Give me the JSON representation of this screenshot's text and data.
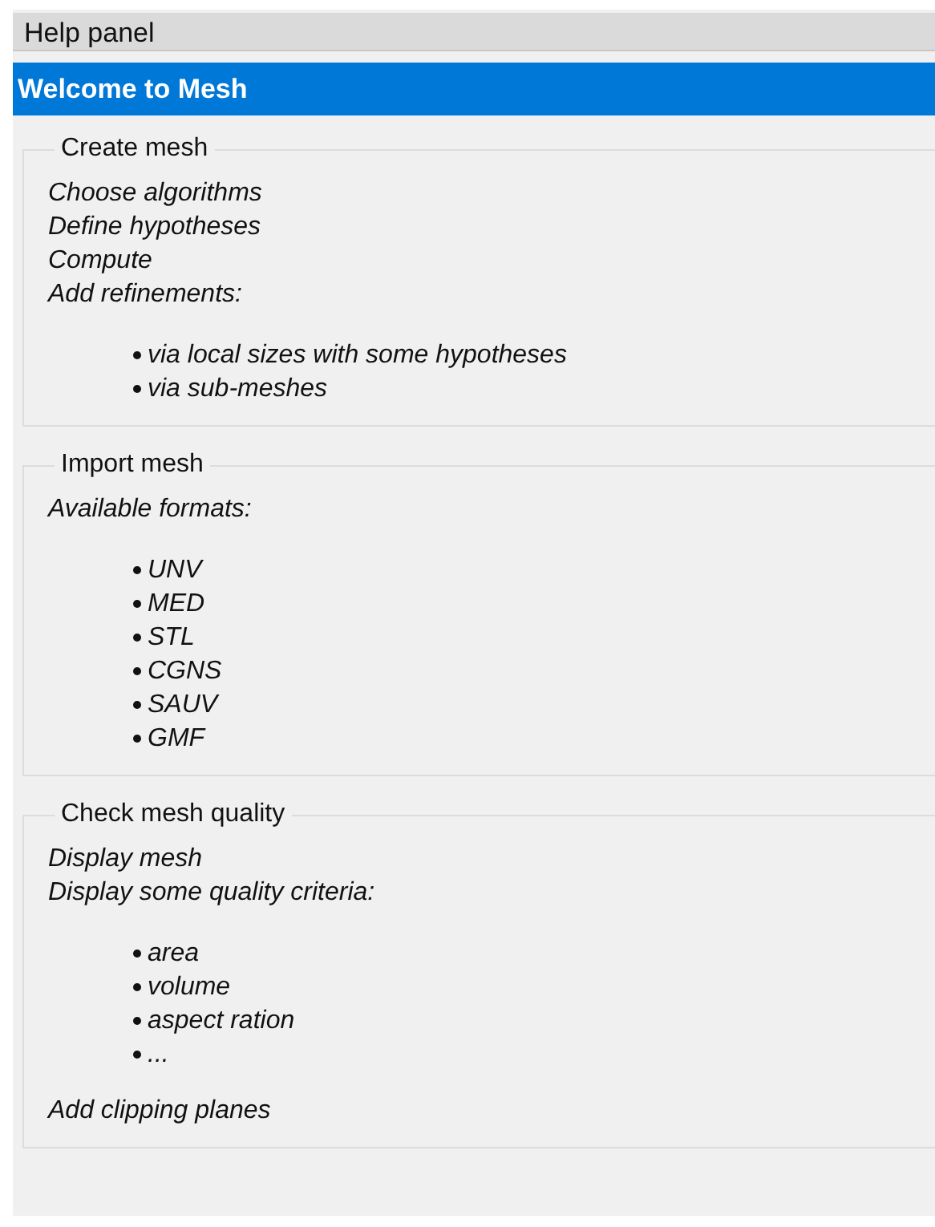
{
  "panel_title": "Help panel",
  "banner": "Welcome to Mesh",
  "sections": [
    {
      "title": "Create mesh",
      "blocks": [
        {
          "kind": "lines",
          "lines": [
            "Choose algorithms",
            "Define hypotheses",
            "Compute",
            "Add refinements:"
          ]
        },
        {
          "kind": "bullets",
          "items": [
            "via local sizes with some hypotheses",
            "via sub-meshes"
          ]
        }
      ]
    },
    {
      "title": "Import mesh",
      "blocks": [
        {
          "kind": "lines",
          "lines": [
            "Available formats:"
          ]
        },
        {
          "kind": "bullets",
          "items": [
            "UNV",
            "MED",
            "STL",
            "CGNS",
            "SAUV",
            "GMF"
          ]
        }
      ]
    },
    {
      "title": "Check mesh quality",
      "blocks": [
        {
          "kind": "lines",
          "lines": [
            "Display mesh",
            "Display some quality criteria:"
          ]
        },
        {
          "kind": "bullets",
          "items": [
            "area",
            "volume",
            "aspect ration",
            "..."
          ]
        },
        {
          "kind": "lines",
          "lines": [
            "Add clipping planes"
          ]
        }
      ]
    }
  ]
}
